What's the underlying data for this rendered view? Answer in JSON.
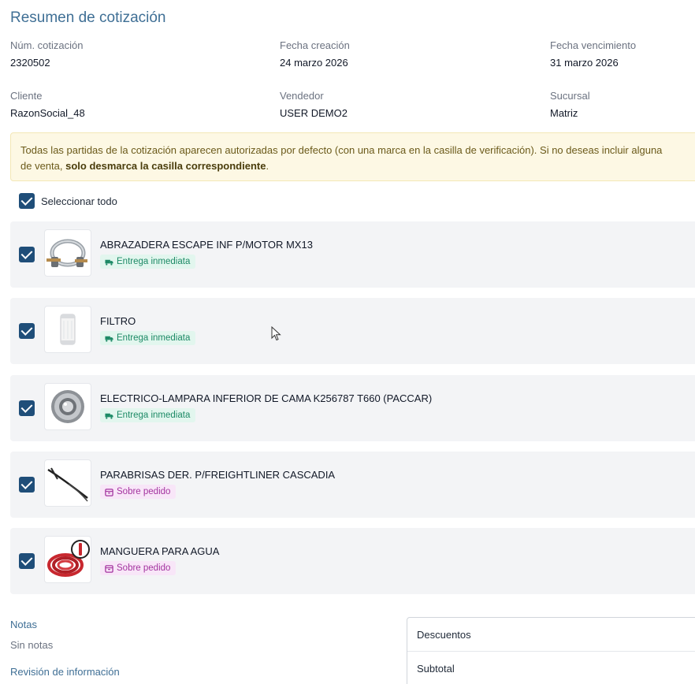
{
  "page": {
    "title": "Resumen de cotización"
  },
  "meta": {
    "quote_number": {
      "label": "Núm. cotización",
      "value": "2320502"
    },
    "created": {
      "label": "Fecha creación",
      "value": "24 marzo 2026"
    },
    "expires": {
      "label": "Fecha vencimiento",
      "value": "31 marzo 2026"
    },
    "client": {
      "label": "Cliente",
      "value": "RazonSocial_48"
    },
    "seller": {
      "label": "Vendedor",
      "value": "USER DEMO2"
    },
    "branch": {
      "label": "Sucursal",
      "value": "Matriz"
    }
  },
  "alert": {
    "text_before": "Todas las partidas de la cotización aparecen autorizadas por defecto (con una marca en la casilla de verificación). Si no deseas incluir alguna",
    "text_line2": "de venta, ",
    "text_bold": "solo desmarca la casilla correspondiente",
    "text_after": "."
  },
  "select_all": {
    "label": "Seleccionar todo",
    "checked": true
  },
  "items": [
    {
      "name": "ABRAZADERA ESCAPE INF P/MOTOR MX13",
      "badge": "Entrega inmediata",
      "badge_type": "green",
      "checked": true,
      "thumb_icon": "clamp-image"
    },
    {
      "name": "FILTRO",
      "badge": "Entrega inmediata",
      "badge_type": "green",
      "checked": true,
      "thumb_icon": "filter-image"
    },
    {
      "name": "ELECTRICO-LAMPARA INFERIOR DE CAMA K256787 T660 (PACCAR)",
      "badge": "Entrega inmediata",
      "badge_type": "green",
      "checked": true,
      "thumb_icon": "lamp-image"
    },
    {
      "name": "PARABRISAS DER. P/FREIGHTLINER CASCADIA",
      "badge": "Sobre pedido",
      "badge_type": "purple",
      "checked": true,
      "thumb_icon": "wiper-image"
    },
    {
      "name": "MANGUERA PARA AGUA",
      "badge": "Sobre pedido",
      "badge_type": "purple",
      "checked": true,
      "thumb_icon": "hose-image"
    }
  ],
  "notes": {
    "label": "Notas",
    "value": "Sin notas"
  },
  "review": {
    "label": "Revisión de información"
  },
  "totals": {
    "discounts_label": "Descuentos",
    "subtotal_label": "Subtotal"
  },
  "colors": {
    "accent": "#3f6f95",
    "checkbox": "#1f4e79",
    "green_badge_text": "#1d8a66",
    "purple_badge_text": "#a3349f",
    "alert_bg": "#fdf8e4"
  }
}
